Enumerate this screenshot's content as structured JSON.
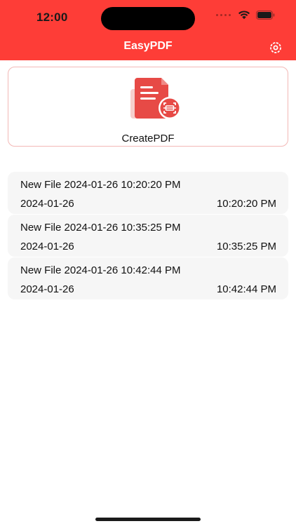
{
  "status_bar": {
    "time": "12:00"
  },
  "nav": {
    "title": "EasyPDF",
    "settings_icon": "gear-icon"
  },
  "create_card": {
    "label": "CreatePDF",
    "icon": "pdf-scan-document-icon",
    "accent": "#e74a46"
  },
  "files": [
    {
      "name": "New File 2024-01-26 10:20:20 PM",
      "date": "2024-01-26",
      "time": "10:20:20 PM"
    },
    {
      "name": "New File 2024-01-26 10:35:25 PM",
      "date": "2024-01-26",
      "time": "10:35:25 PM"
    },
    {
      "name": "New File 2024-01-26 10:42:44 PM",
      "date": "2024-01-26",
      "time": "10:42:44 PM"
    }
  ],
  "colors": {
    "header_bg": "#fe3d37",
    "row_bg": "#f6f6f6",
    "card_border": "#f3b8b6"
  }
}
